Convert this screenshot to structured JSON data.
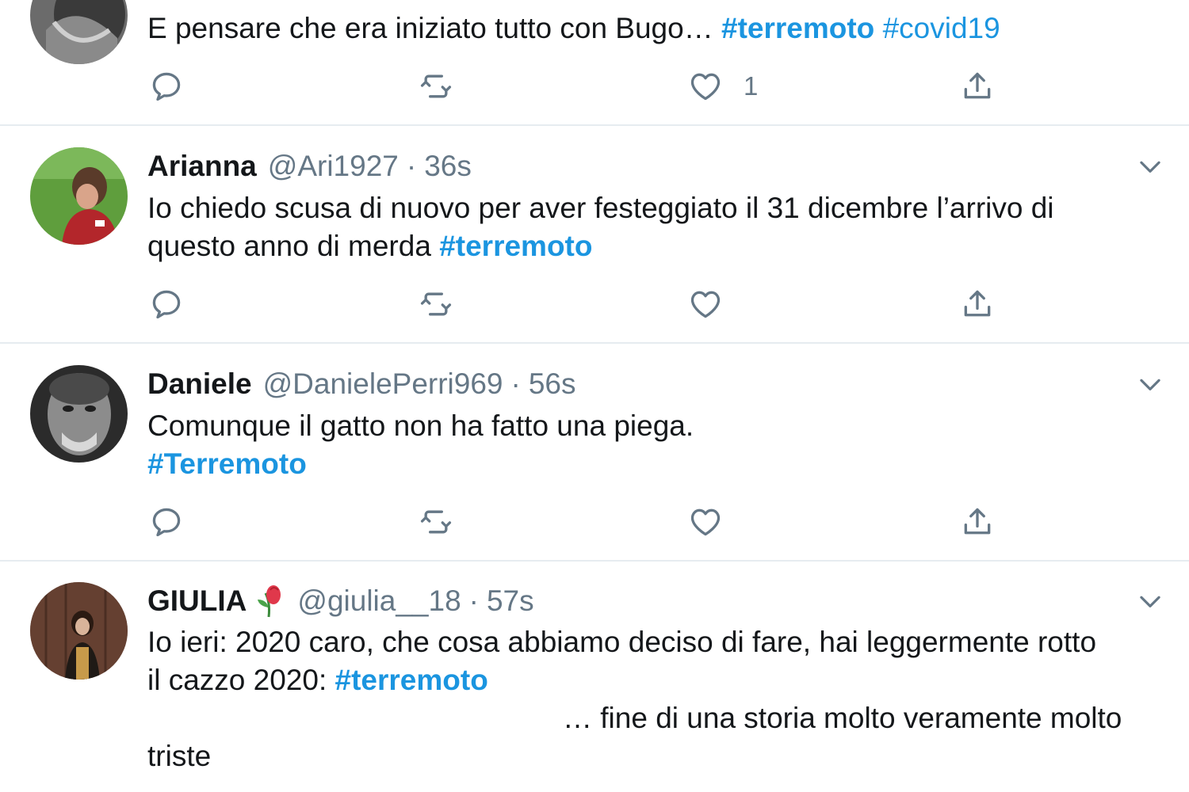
{
  "colors": {
    "accent": "#1b95e0",
    "secondary": "#657786",
    "divider": "#e6ecf0"
  },
  "tweets": [
    {
      "lines": [
        {
          "text": "E pensare che era iniziato tutto con Bugo… ",
          "tags": [
            "#terremoto",
            "#covid19"
          ]
        }
      ],
      "like_count": "1"
    },
    {
      "name": "Arianna",
      "handle": "@Ari1927",
      "separator": "·",
      "time": "36s",
      "lines": [
        {
          "text": "Io chiedo scusa di nuovo per aver festeggiato il 31 dicembre l’arrivo di"
        },
        {
          "text": "questo anno di merda ",
          "tag": "#terremoto"
        }
      ]
    },
    {
      "name": "Daniele",
      "handle": "@DanielePerri969",
      "separator": "·",
      "time": "56s",
      "lines": [
        {
          "text": "Comunque il gatto non ha fatto una piega."
        },
        {
          "tag": "#Terremoto"
        }
      ]
    },
    {
      "name": "GIULIA",
      "handle": "@giulia__18",
      "separator": "·",
      "time": "57s",
      "lines": [
        {
          "text": "Io ieri: 2020 caro, che cosa abbiamo deciso di fare, hai leggermente rotto"
        },
        {
          "text": "il cazzo 2020: ",
          "tag": "#terremoto"
        },
        {
          "text": "… fine di una storia molto veramente molto"
        },
        {
          "text": "triste"
        }
      ]
    }
  ],
  "icons": {
    "reply": "reply-icon",
    "retweet": "retweet-icon",
    "like": "heart-icon",
    "share": "share-icon",
    "caret": "chevron-down-icon",
    "emoji": "wilted-flower-emoji"
  }
}
